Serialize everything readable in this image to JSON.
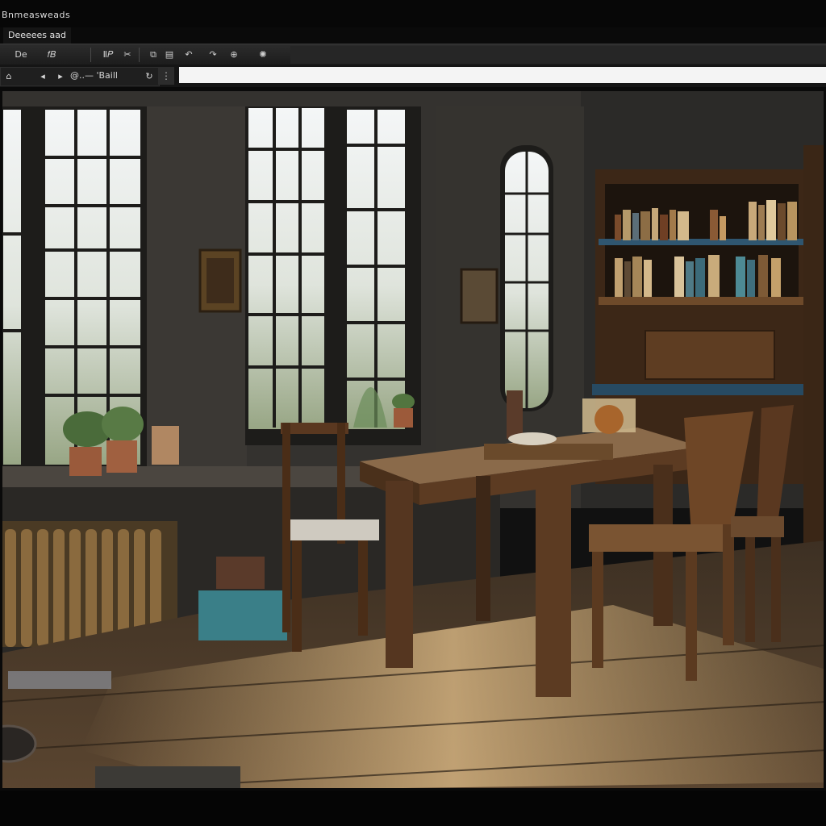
{
  "window": {
    "app_title": "Bnmeasweads",
    "document_title": "Deeeees aad"
  },
  "toolbar": {
    "buttons": [
      {
        "icon": "back-icon",
        "glyph": "De"
      },
      {
        "icon": "save-icon",
        "glyph": "𝑓𝐵"
      },
      {
        "icon": "bold-icon",
        "glyph": "Ⅱ𝑃"
      },
      {
        "icon": "cut-icon",
        "glyph": "✂"
      },
      {
        "icon": "copy-icon",
        "glyph": "⧉"
      },
      {
        "icon": "paste-icon",
        "glyph": "▤"
      },
      {
        "icon": "undo-icon",
        "glyph": "↶"
      },
      {
        "icon": "redo-icon",
        "glyph": "↷"
      },
      {
        "icon": "zoom-icon",
        "glyph": "⊕"
      },
      {
        "icon": "settings-icon",
        "glyph": "✺"
      }
    ]
  },
  "addressbar": {
    "nav_buttons": [
      {
        "icon": "home-icon",
        "glyph": "⌂"
      },
      {
        "icon": "back-icon",
        "glyph": "◂"
      },
      {
        "icon": "forward-icon",
        "glyph": "▸"
      },
      {
        "icon": "refresh-icon",
        "glyph": "↻"
      }
    ],
    "location_label": "@..— 'Baill",
    "url_value": "",
    "grip_glyph": "⋮"
  },
  "viewport": {
    "image": "dimly-lit-study-room-with-wooden-table-chairs-windows-and-bookshelf",
    "colors": {
      "wall": "#3c3a37",
      "window_light": "#e8ecef",
      "wood": "#5c3b22",
      "floor": "#6b5337",
      "sunlight": "#c9a46b",
      "radiator": "#8a6a3e"
    }
  }
}
